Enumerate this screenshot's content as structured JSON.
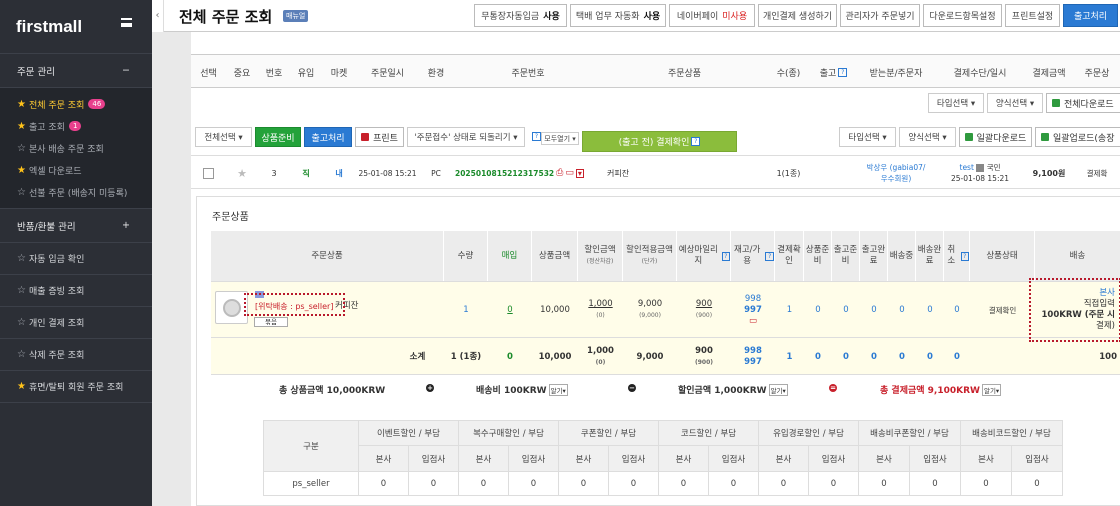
{
  "brand": "firstmall",
  "sidebar": {
    "section1": "주문 관리",
    "section1_toggle": "−",
    "items": [
      {
        "label": "전체 주문 조회",
        "badge": "46",
        "active": true,
        "filled": true
      },
      {
        "label": "출고 조회",
        "badge": "1",
        "active": false,
        "filled": true
      },
      {
        "label": "본사 배송 주문 조회",
        "badge": "",
        "active": false,
        "filled": false
      },
      {
        "label": "엑셀 다운로드",
        "badge": "",
        "active": false,
        "filled": true
      },
      {
        "label": "선불 주문 (배송지 미등록)",
        "badge": "",
        "active": false,
        "filled": false
      }
    ],
    "section2": "반품/환불 관리",
    "section2_toggle": "+",
    "menus": [
      {
        "label": "자동 입금 확인",
        "filled": false
      },
      {
        "label": "매출 증빙 조회",
        "filled": false
      },
      {
        "label": "개인 결제 조회",
        "filled": false
      },
      {
        "label": "삭제 주문 조회",
        "filled": false
      },
      {
        "label": "휴면/탈퇴 회원 주문 조회",
        "filled": true
      }
    ]
  },
  "header": {
    "title": "전체 주문 조회",
    "manual": "매뉴얼",
    "buttons": [
      {
        "label": "무통장자동입금",
        "state": "사용",
        "state_color": "dark"
      },
      {
        "label": "택배 업무 자동화",
        "state": "사용",
        "state_color": "dark"
      },
      {
        "label": "네이버페이",
        "state": "미사용",
        "state_color": "red"
      },
      {
        "label": "개인결제 생성하기",
        "state": "",
        "state_color": ""
      },
      {
        "label": "관리자가 주문넣기",
        "state": "",
        "state_color": ""
      },
      {
        "label": "다운로드항목설정",
        "state": "",
        "state_color": ""
      },
      {
        "label": "프린트설정",
        "state": "",
        "state_color": ""
      },
      {
        "label": "출고처리",
        "state": "",
        "state_color": "primary"
      }
    ]
  },
  "table_header": [
    "선택",
    "중요",
    "번호",
    "유입",
    "마켓",
    "주문일시",
    "환경",
    "주문번호",
    "주문상품",
    "수(종)",
    "출고",
    "받는분/주문자",
    "결제수단/일시",
    "결제금액",
    "주문상"
  ],
  "top_controls": {
    "type_select": "타입선택 ▾",
    "form_select": "양식선택 ▾",
    "all_download": "전체다운로드"
  },
  "actions": {
    "select_all": "전체선택 ▾",
    "prepare": "상품준비",
    "ship": "출고처리",
    "print": "프린트",
    "revert": "'주문접수' 상태로 되돌리기 ▾",
    "expand": "모두열기 ▾",
    "green_banner": "(출고 전) 결제확인",
    "type_select": "타입선택 ▾",
    "form_select": "양식선택 ▾",
    "bulk_download": "일괄다운로드",
    "bulk_upload": "일괄업로드(송장"
  },
  "order": {
    "number": "3",
    "inflow": "직",
    "market": "내",
    "datetime": "25-01-08 15:21",
    "env": "PC",
    "order_no": "2025010815212317532",
    "product": "커피잔",
    "qty": "1(1종)",
    "recipient": "박상우 (gabia07/",
    "recipient_grade": "우수회원)",
    "buyer": "test",
    "buyer_tag": "국민",
    "pay_time": "25-01-08 15:21",
    "amount": "9,100원",
    "status": "결제확"
  },
  "panel": {
    "title": "주문상품",
    "columns": [
      "주문상품",
      "수량",
      "매입",
      "상품금액",
      "할인금액",
      "할인적용금액",
      "예상마일리지",
      "재고/가용",
      "결제확인",
      "상품준비",
      "출고준비",
      "출고완료",
      "배송중",
      "배송완료",
      "취소",
      "상품상태",
      "배송"
    ],
    "col_subs": {
      "discount": "(정산차감)",
      "applied": "(단가)"
    },
    "item": {
      "tag": "[위탁배송 : ps_seller]",
      "name": "커피잔",
      "qty": "1",
      "purchase": "0",
      "price": "10,000",
      "discount": "1,000",
      "discount_sub": "(0)",
      "applied": "9,000",
      "applied_sub": "(9,000)",
      "mileage": "900",
      "mileage_sub": "(900)",
      "stock": "998",
      "avail": "997",
      "s1": "1",
      "s2": "0",
      "s3": "0",
      "s4": "0",
      "s5": "0",
      "s6": "0",
      "s7": "0",
      "state": "결제확인",
      "ship_who": "본사",
      "ship_detail": "직접입력",
      "ship_fee": "100KRW (주문 시",
      "ship_when": "결제)",
      "badge": "묶음"
    },
    "subtotal": {
      "label": "소계",
      "qty": "1 (1종)",
      "purchase": "0",
      "price": "10,000",
      "discount": "1,000",
      "discount_sub": "(0)",
      "applied": "9,000",
      "mileage": "900",
      "mileage_sub": "(900)",
      "stock": "998",
      "avail": "997",
      "s1": "1",
      "s2": "0",
      "s3": "0",
      "s4": "0",
      "s5": "0",
      "s6": "0",
      "s7": "0",
      "ship": "100"
    },
    "totals": {
      "product": "총 상품금액 10,000KRW",
      "plus": "+",
      "shipping": "배송비 100KRW",
      "minus": "−",
      "discount": "할인금액 1,000KRW",
      "equals": "=",
      "pay": "총 결제금액 9,100KRW",
      "more": "알기▾"
    },
    "discount_table": {
      "title": "구분",
      "groups": [
        "이벤트할인 / 부담",
        "복수구매할인 / 부담",
        "쿠폰할인 / 부담",
        "코드할인 / 부담",
        "유입경로할인 / 부담",
        "배송비쿠폰할인 / 부담",
        "배송비코드할인 / 부담"
      ],
      "sub": [
        "본사",
        "입점사"
      ],
      "row_label": "ps_seller",
      "values": [
        "0",
        "0",
        "0",
        "0",
        "0",
        "0",
        "0",
        "0",
        "0",
        "0",
        "0",
        "0",
        "0",
        "0"
      ]
    }
  }
}
